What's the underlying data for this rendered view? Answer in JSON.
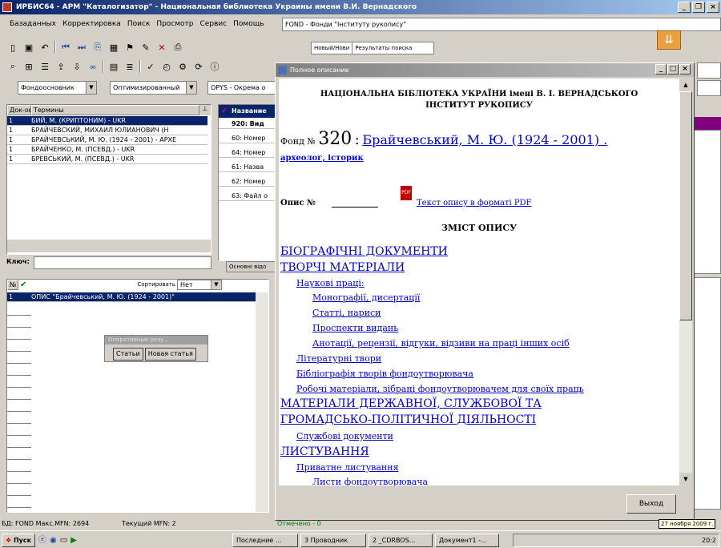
{
  "window": {
    "title": "ИРБИС64 - АРМ \"Каталогизатор\" - Национальная библиотека Украины имени В.И. Вернадского"
  },
  "menu": [
    "Базаданных",
    "Корректировка",
    "Поиск",
    "Просмотр",
    "Сервис",
    "Помощь"
  ],
  "db_combo": "FOND - Фонди \"Інституту рукопису\"",
  "tabs_top": [
    "Новый/Нови",
    "Результаты поиска"
  ],
  "filters": {
    "mode": "Фондоосновник",
    "sort": "Оптимизированный",
    "format": "OPYS - Окрема о"
  },
  "terms_panel": {
    "col_count": "Док-ов",
    "col_term": "Термины",
    "rows": [
      {
        "n": "1",
        "term": "БИЙ, М. (КРИПТОНИМ) - UKR"
      },
      {
        "n": "1",
        "term": "БРАЙЧЕВСКИЙ, МИХАИЛ ЮЛИАНОВИЧ (Н"
      },
      {
        "n": "1",
        "term": "БРАЙЧЕВСЬКИЙ, М. Ю. (1924 - 2001) - АРХЕ"
      },
      {
        "n": "1",
        "term": "БРАЙЧЕНКО, М. (ПСЕВД.) - UKR"
      },
      {
        "n": "1",
        "term": "БРЕВСЬКИЙ, М. (ПСЕВД.) - UKR"
      }
    ],
    "key_label": "Ключ:"
  },
  "fields_panel": {
    "header": "Название",
    "rows": [
      "920: Вид",
      "60: Номер",
      "64: Номер",
      "61: Назва",
      "62: Номер",
      "63: Файл о"
    ],
    "tab": "Основні відо"
  },
  "results_panel": {
    "sort_label": "Сортировать",
    "sort_value": "Нет",
    "col_n": "№",
    "rows": [
      {
        "n": "1",
        "text": "ОПИС \"Брайчевський, М. Ю. (1924 - 2001)\""
      }
    ]
  },
  "popup": {
    "title": "Оперативные резу...",
    "btn1": "Статьи",
    "btn2": "Новая статья"
  },
  "dialog": {
    "title": "Полное описание",
    "header1": "НАЦІОНАЛЬНА БІБЛІОТЕКА УКРАЇНИ імені В. І. ВЕРНАДСЬКОГО",
    "header2": "ІНСТИТУТ РУКОПИСУ",
    "fond_label": "Фонд №",
    "fond_num": "320",
    "fond_sep": ":",
    "fond_name": "Брайчевський, М. Ю. (1924 - 2001) .",
    "fond_sub": "археолог, історик",
    "opys_label": "Опис №",
    "pdf_link": "Текст опису в форматі PDF",
    "toc_title": "ЗМІСТ ОПИСУ",
    "toc": [
      {
        "text": "БІОГРАФІЧНІ ДОКУМЕНТИ",
        "lvl": 0
      },
      {
        "text": "ТВОРЧІ МАТЕРІАЛИ",
        "lvl": 0
      },
      {
        "text": "Наукові праці:",
        "lvl": 1
      },
      {
        "text": "Монографії, дисертації",
        "lvl": 2
      },
      {
        "text": "Статті, нариси",
        "lvl": 2
      },
      {
        "text": "Проспекти видань",
        "lvl": 2
      },
      {
        "text": "Анотації, рецензії, відгуки, відзиви на праці інших осіб",
        "lvl": 2
      },
      {
        "text": "Літературні твори",
        "lvl": 1
      },
      {
        "text": "Бібліографія творів фондоутворювача",
        "lvl": 1
      },
      {
        "text": "Робочі матеріали, зібрані фондоутворювачем для своїх праць",
        "lvl": 1
      },
      {
        "text": "МАТЕРІАЛИ ДЕРЖАВНОЇ, СЛУЖБОВОЇ ТА",
        "lvl": 0
      },
      {
        "text": "ГРОМАДСЬКО-ПОЛІТИЧНОЇ ДІЯЛЬНОСТІ",
        "lvl": 0
      },
      {
        "text": "Службові документи",
        "lvl": 1
      },
      {
        "text": "ЛИСТУВАННЯ",
        "lvl": 0
      },
      {
        "text": "Приватне листування",
        "lvl": 1
      },
      {
        "text": "Листи фондоутворювача",
        "lvl": 2
      }
    ],
    "exit": "Выход"
  },
  "status": {
    "db": "БД: FOND Макс.MFN: 2694",
    "mfn": "Текущий MFN: 2",
    "marked": "Отмечено - 0"
  },
  "taskbar": {
    "start": "Пуск",
    "tasks": [
      "Последние ...",
      "3 Проводник",
      "2 _CDRBOS...",
      "Документ1 -..."
    ],
    "clock": "20:2",
    "date_tip": "27 ноября 2009 г."
  },
  "colors": {
    "title_active": "#0a246a",
    "link": "#0000cc",
    "selection": "#0a246a",
    "accent_purple": "#800080"
  }
}
